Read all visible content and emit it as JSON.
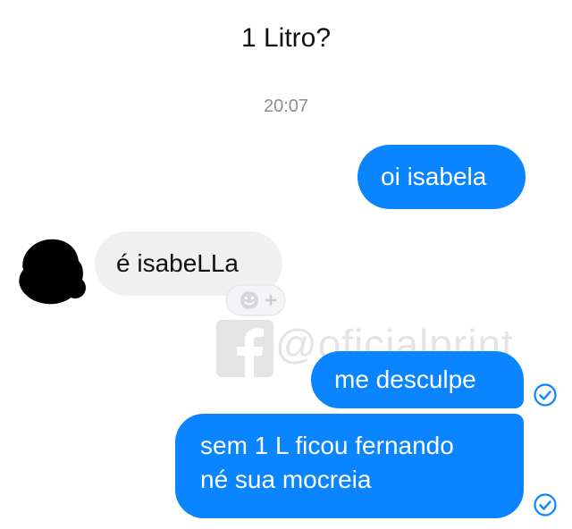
{
  "caption": "1 Litro?",
  "conversation": {
    "timestamp": "20:07",
    "messages": [
      {
        "direction": "outgoing",
        "text": "oi isabela"
      },
      {
        "direction": "incoming",
        "text": "é isabeLLa"
      },
      {
        "direction": "outgoing",
        "text": "me desculpe",
        "status": "sent"
      },
      {
        "direction": "outgoing",
        "lines": [
          "sem 1 L ficou fernando",
          "né sua mocreia"
        ],
        "status": "sent"
      }
    ]
  },
  "watermark": {
    "text": "@oficialprint",
    "icon": "facebook-icon"
  },
  "icons": {
    "avatar": "avatar",
    "reaction": "add-reaction-icon",
    "status": "sent-check-icon"
  },
  "colors": {
    "outgoing_bubble": "#0a84ff",
    "incoming_bubble": "#f0f0f0",
    "timestamp": "#8e8e93",
    "check": "#0a84ff"
  }
}
